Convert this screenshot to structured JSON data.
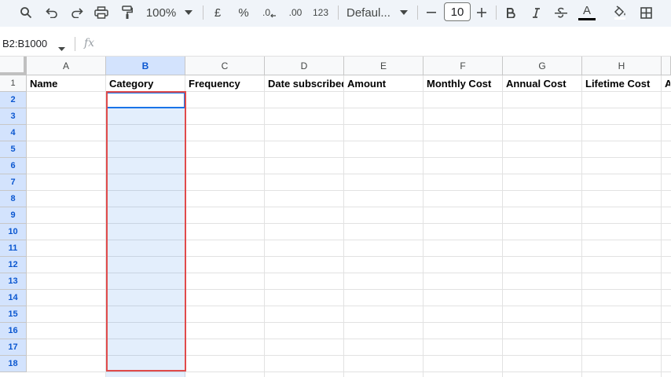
{
  "toolbar": {
    "zoom": "100%",
    "currency_symbol": "£",
    "percent_symbol": "%",
    "decrease_decimal": ".0",
    "increase_decimal": ".00",
    "number_format": "123",
    "font_name": "Defaul...",
    "font_size": "10",
    "text_color_letter": "A",
    "icons": [
      "search-icon",
      "undo-icon",
      "redo-icon",
      "print-icon",
      "paint-format-icon",
      "currency-icon",
      "percent-icon",
      "decrease-decimal-icon",
      "increase-decimal-icon",
      "minus-icon",
      "plus-icon",
      "bold-icon",
      "italic-icon",
      "strikethrough-icon",
      "text-color-icon",
      "fill-color-icon",
      "borders-icon"
    ]
  },
  "formula_bar": {
    "name_box": "B2:B1000",
    "fx_label": "fx",
    "value": ""
  },
  "grid": {
    "columns": [
      "A",
      "B",
      "C",
      "D",
      "E",
      "F",
      "G",
      "H",
      ""
    ],
    "selected_column": "B",
    "rows": [
      "1",
      "2",
      "3",
      "4",
      "5",
      "6",
      "7",
      "8",
      "9",
      "10",
      "11",
      "12",
      "13",
      "14",
      "15",
      "16",
      "17",
      "18"
    ],
    "header_row": [
      "Name",
      "Category",
      "Frequency",
      "Date subscribed",
      "Amount",
      "Monthly Cost",
      "Annual Cost",
      "Lifetime Cost",
      "A"
    ],
    "selection_range": "B2:B1000"
  },
  "colors": {
    "toolbar_bg": "#f0f4f9",
    "selection_fill": "#e8f0fe",
    "selection_border": "#1a73e8",
    "highlight_box": "#e04b4b",
    "header_selected": "#d3e3fd"
  }
}
